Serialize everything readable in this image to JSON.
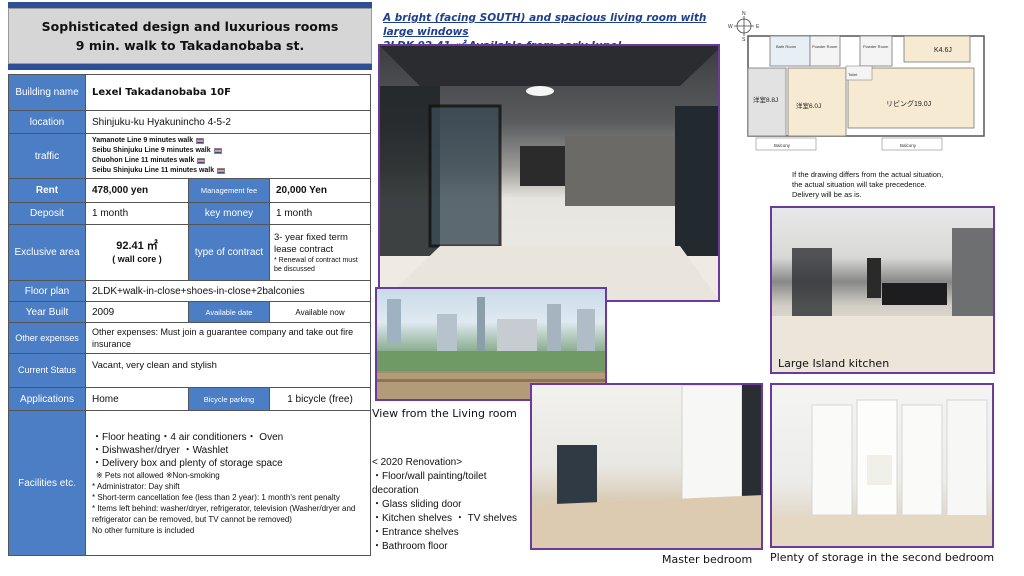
{
  "header": {
    "line1": "Sophisticated design and luxurious rooms",
    "line2": "9 min. walk to Takadanobaba st."
  },
  "table": {
    "building_name_label": "Building name",
    "building_name": "Lexel Takadanobaba 10F",
    "location_label": "location",
    "location": "Shinjuku-ku Hyakunincho 4-5-2",
    "traffic_label": "traffic",
    "traffic": [
      "Yamanote Line 9 minutes walk",
      "Seibu Shinjuku Line 9 minutes walk",
      "Chuohon Line 11 minutes walk",
      "Seibu Shinjuku Line 11 minutes walk"
    ],
    "rent_label": "Rent",
    "rent": "478,000 yen",
    "management_fee_label": "Management fee",
    "management_fee": "20,000 Yen",
    "deposit_label": "Deposit",
    "deposit": "1 month",
    "key_money_label": "key money",
    "key_money": "1 month",
    "exclusive_area_label": "Exclusive area",
    "exclusive_area": "92.41 ㎡",
    "exclusive_area_note": "( wall core )",
    "contract_type_label": "type of contract",
    "contract_type": "3- year fixed term lease contract",
    "contract_note": "* Renewal of contract must be discussed",
    "floor_plan_label": "Floor plan",
    "floor_plan": "2LDK+walk-in-close+shoes-in-close+2balconies",
    "year_built_label": "Year Built",
    "year_built": "2009",
    "available_date_label": "Available date",
    "available_date": "Available now",
    "other_expenses_label": "Other expenses",
    "other_expenses": "Other expenses: Must join a guarantee company and take out fire insurance",
    "current_status_label": "Current Status",
    "current_status": "Vacant, very clean and stylish",
    "applications_label": "Applications",
    "applications": "Home",
    "bicycle_parking_label": "Bicycle parking",
    "bicycle_parking": "1 bicycle (free)",
    "facilities_label": "Facilities etc.",
    "facilities_main": [
      "・Floor heating・4 air conditioners・ Oven",
      "・Dishwasher/dryer ・Washlet",
      "・Delivery box and plenty of storage space"
    ],
    "facilities_pets": "※ Pets not allowed ※Non-smoking",
    "facilities_notes": [
      "* Administrator: Day shift",
      "* Short-term cancellation fee (less than 2 year): 1 month's rent penalty",
      "* Items left behind: washer/dryer, refrigerator, television (Washer/dryer and refrigerator can be removed, but TV cannot be removed)",
      "No other furniture is included"
    ]
  },
  "top_caption": {
    "line1": "A bright (facing SOUTH) and spacious living room with large windows",
    "line2": "2LDK 92.41 ㎡ Available from early June!"
  },
  "floorplan": {
    "rooms": {
      "k": "K4.6J",
      "western1": "洋室8.8J",
      "western2": "洋室6.0J",
      "living": "リビング19.0J",
      "bath": "Bath Room",
      "powder1": "Powder Room",
      "powder2": "Powder Room",
      "toilet": "Toilet",
      "balcony1": "Balcony",
      "balcony2": "Balcony"
    },
    "compass": {
      "n": "N",
      "e": "E",
      "w": "W",
      "s": "S"
    }
  },
  "notice": [
    "If the drawing differs from the actual situation,",
    "the actual situation will take precedence.",
    "Delivery will be as is."
  ],
  "captions": {
    "view": "View from the Living room",
    "kitchen": "Large Island kitchen",
    "master": "Master bedroom",
    "storage": "Plenty of storage in the second bedroom"
  },
  "renovation": [
    "< 2020 Renovation>",
    "・Floor/wall painting/toilet decoration",
    "・Glass sliding door",
    "・Kitchen shelves ・ TV shelves",
    "・Entrance shelves",
    "・Bathroom floor"
  ],
  "colors": {
    "accent_blue": "#2e4f96",
    "label_blue": "#4c7ec6",
    "photo_border": "#6b3a9a"
  }
}
